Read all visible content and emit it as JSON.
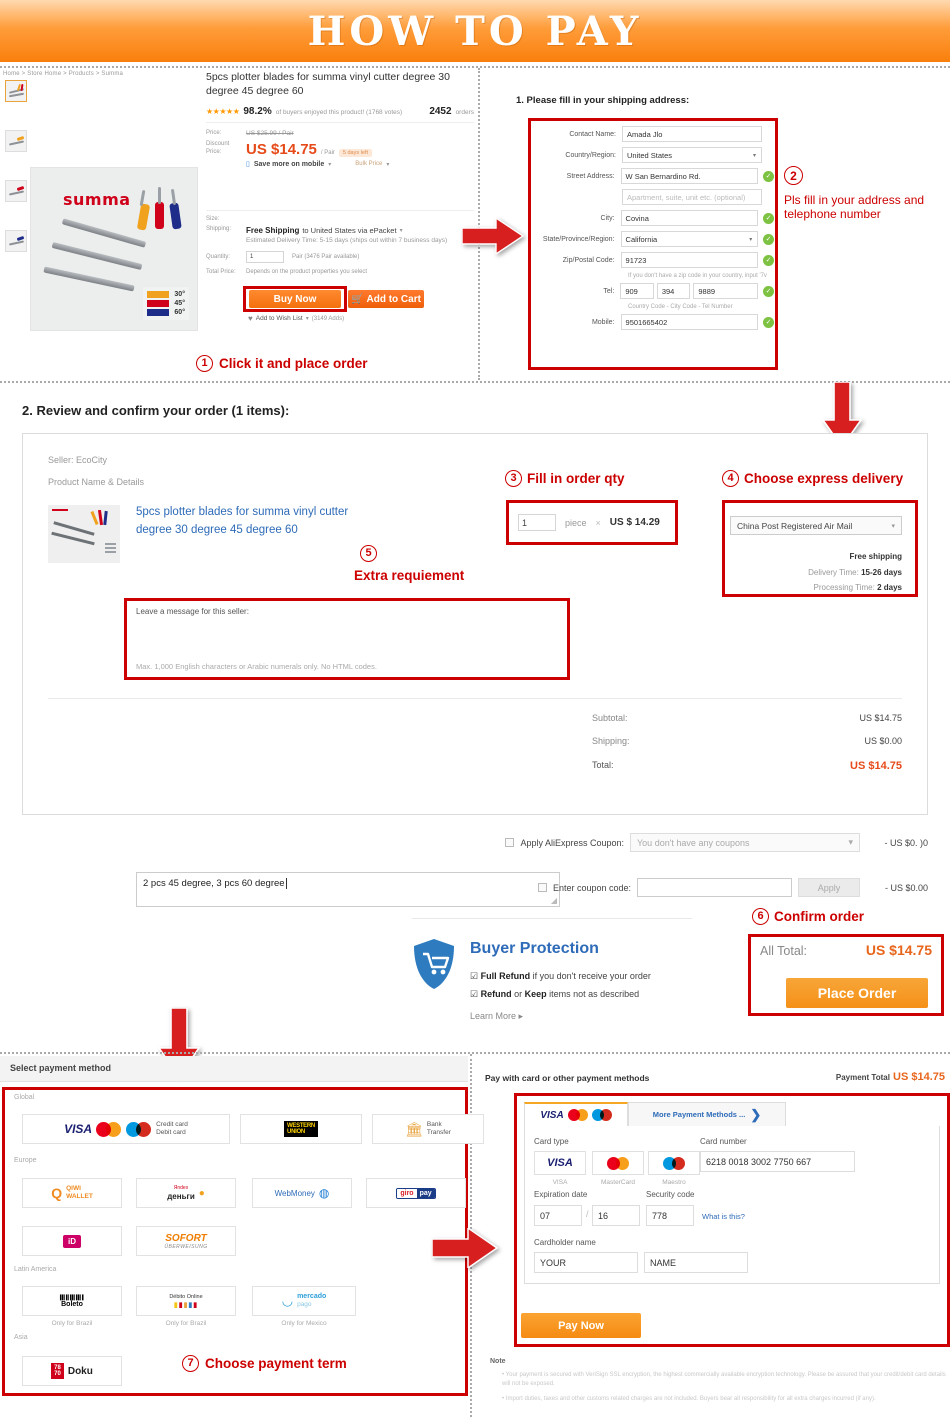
{
  "banner": {
    "title": "HOW TO PAY"
  },
  "product": {
    "breadcrumb": "Home > Store Home > Products > Summa",
    "title": "5pcs plotter blades for summa vinyl cutter degree 30 degree 45 degree 60",
    "brand_watermark": "summa",
    "stars": "★★★★★",
    "rating_pct": "98.2%",
    "rating_text": "of buyers enjoyed this product! (1768 votes)",
    "orders_count": "2452",
    "orders_label": "orders",
    "legend": [
      {
        "color": "#f0a21e",
        "label": "30°"
      },
      {
        "color": "#d0021b",
        "label": "45°"
      },
      {
        "color": "#1f2d8a",
        "label": "60°"
      }
    ],
    "price_label": "Price:",
    "price_old": "US $25.99 / Pair",
    "discount_label": "Discount Price:",
    "price_now": "US $14.75",
    "price_unit": "/ Pair",
    "days_left": "5 days left",
    "mobile_save": "Save more on mobile",
    "bulk_price": "Bulk Price",
    "size_label": "Size:",
    "shipping_label": "Shipping:",
    "shipping_free": "Free Shipping",
    "shipping_to": "to United States via ePacket",
    "shipping_eta": "Estimated Delivery Time: 5-15 days (ships out within 7 business days)",
    "qty_label": "Quantity:",
    "qty_value": "1",
    "qty_avail": "Pair (3476 Pair available)",
    "total_price_label": "Total Price:",
    "total_price_value": "Depends on the product properties you select",
    "buy_now": "Buy Now",
    "add_to_cart": "Add to Cart",
    "wish_list": "Add to Wish List",
    "wish_count": "(3149 Adds)"
  },
  "annotations": {
    "a1_num": "1",
    "a1_text": "Click it and place order",
    "a2_num": "2",
    "a2_line1": "Pls fill in your address and",
    "a2_line2": "telephone number",
    "a3_num": "3",
    "a3_text": "Fill in order qty",
    "a4_num": "4",
    "a4_text": "Choose express delivery",
    "a5_num": "5",
    "a5_text": "Extra requiement",
    "a6_num": "6",
    "a6_text": "Confirm order",
    "a7_num": "7",
    "a7_text": "Choose payment term"
  },
  "address": {
    "heading": "1. Please fill in your shipping address:",
    "fields": [
      {
        "label": "Contact Name:",
        "value": "Amada  Jlo",
        "type": "text",
        "check": false
      },
      {
        "label": "Country/Region:",
        "value": "United States",
        "type": "select",
        "check": false
      },
      {
        "label": "Street Address:",
        "value": "W San Bernardino Rd.",
        "type": "text",
        "check": true
      },
      {
        "label": "",
        "value": "Apartment, suite, unit etc. (optional)",
        "type": "placeholder",
        "check": false
      },
      {
        "label": "City:",
        "value": "Covina",
        "type": "text",
        "check": true
      },
      {
        "label": "State/Province/Region:",
        "value": "California",
        "type": "select",
        "check": true
      },
      {
        "label": "Zip/Postal Code:",
        "value": "91723",
        "type": "text",
        "check": true
      }
    ],
    "zip_hint": "If you don't have a zip code in your country, input '7v",
    "tel_label": "Tel:",
    "tel_country": "909",
    "tel_city": "394",
    "tel_number": "9889",
    "tel_hint": "Country Code - City Code - Tel Number",
    "mobile_label": "Mobile:",
    "mobile_value": "9501665402"
  },
  "order": {
    "heading": "2. Review and confirm your order (1 items):",
    "seller_label": "Seller: EcoCity",
    "pnd_label": "Product Name & Details",
    "product_link": "5pcs plotter blades for summa vinyl cutter degree 30 degree 45 degree 60",
    "qty_value": "1",
    "qty_unit": "piece",
    "qty_times": "×",
    "unit_price": "US $ 14.29",
    "shipping_method": "China Post Registered Air Mail",
    "free_shipping": "Free shipping",
    "delivery_time_label": "Delivery Time:",
    "delivery_time_value": "15-26 days",
    "processing_time_label": "Processing Time:",
    "processing_time_value": "2 days",
    "msg_label": "Leave a message for this seller:",
    "msg_value": "2 pcs 45 degree, 3 pcs 60 degree",
    "msg_hint": "Max. 1,000 English characters or Arabic numerals only. No HTML codes.",
    "totals": [
      {
        "key": "Subtotal:",
        "value": "US $14.75"
      },
      {
        "key": "Shipping:",
        "value": "US $0.00"
      },
      {
        "key": "Total:",
        "value": "US $14.75"
      }
    ]
  },
  "coupon": {
    "ali_label": "Apply AliExpress Coupon:",
    "ali_placeholder": "You don't have any coupons",
    "ali_amount": "- US $0. )0",
    "code_label": "Enter coupon code:",
    "code_value": "",
    "apply_label": "Apply",
    "code_amount": "- US $0.00"
  },
  "buyer_protection": {
    "title": "Buyer Protection",
    "item1_strong": "Full Refund",
    "item1_rest": " if you don't receive your order",
    "item2_a": "Refund",
    "item2_or": " or ",
    "item2_b": "Keep",
    "item2_rest": " items not as described",
    "learn_more": "Learn More",
    "all_total_label": "All Total:",
    "all_total_value": "US $14.75",
    "place_order": "Place Order"
  },
  "payment_panel": {
    "title": "Select payment method",
    "groups": [
      {
        "name": "Global",
        "tiles": [
          {
            "kind": "cards",
            "text1": "Credit card",
            "text2": "Debit card",
            "caption": ""
          },
          {
            "kind": "westernunion",
            "text1": "WESTERN",
            "text2": "UNION",
            "caption": ""
          },
          {
            "kind": "bank",
            "text1": "Bank",
            "text2": "Transfer",
            "caption": ""
          }
        ]
      },
      {
        "name": "Europe",
        "tiles": [
          {
            "kind": "qiwi",
            "text1": "QIWI",
            "text2": "WALLET",
            "caption": ""
          },
          {
            "kind": "yandex",
            "text1": "Яndex",
            "text2": "деньги",
            "caption": ""
          },
          {
            "kind": "webmoney",
            "text1": "WebMoney",
            "text2": "",
            "caption": ""
          },
          {
            "kind": "giropay",
            "text1": "giro",
            "text2": "pay",
            "caption": ""
          },
          {
            "kind": "ideal",
            "text1": "iD",
            "text2": "",
            "caption": ""
          },
          {
            "kind": "sofort",
            "text1": "SOFORT",
            "text2": "ÜBERWEISUNG",
            "caption": ""
          }
        ]
      },
      {
        "name": "Latin America",
        "tiles": [
          {
            "kind": "boleto",
            "text1": "Boleto",
            "text2": "",
            "caption": "Only for Brazil"
          },
          {
            "kind": "debito",
            "text1": "Débito Online",
            "text2": "",
            "caption": "Only for Brazil"
          },
          {
            "kind": "mercado",
            "text1": "mercado",
            "text2": "pago",
            "caption": "Only for Mexico"
          }
        ]
      },
      {
        "name": "Asia",
        "tiles": [
          {
            "kind": "doku",
            "text1": "Doku",
            "text2": "",
            "caption": ""
          }
        ]
      }
    ]
  },
  "card_form": {
    "heading": "Pay with card or other payment methods",
    "payment_total_label": "Payment Total",
    "payment_total_value": "US $14.75",
    "tab_more": "More Payment Methods ...",
    "card_type_label": "Card type",
    "card_types": [
      "VISA",
      "MasterCard",
      "Maestro"
    ],
    "card_number_label": "Card number",
    "card_number_value": "6218 0018 3002 7750 667",
    "exp_label": "Expiration date",
    "exp_month": "07",
    "exp_sep": "/",
    "exp_year": "16",
    "cvv_label": "Security code",
    "cvv_value": "778",
    "cvv_help": "What is this?",
    "name_label": "Cardholder name",
    "name_first": "YOUR",
    "name_last": "NAME",
    "pay_now": "Pay Now",
    "note_title": "Note",
    "note1": "Your payment is secured with VeriSign SSL encryption, the highest commercially available encryption technology. Please be assured that your credit/debit card details will not be exposed.",
    "note2": "Import duties, taxes and other customs related charges are not included. Buyers bear all responsibility for all extra charges incurred (if any)."
  }
}
